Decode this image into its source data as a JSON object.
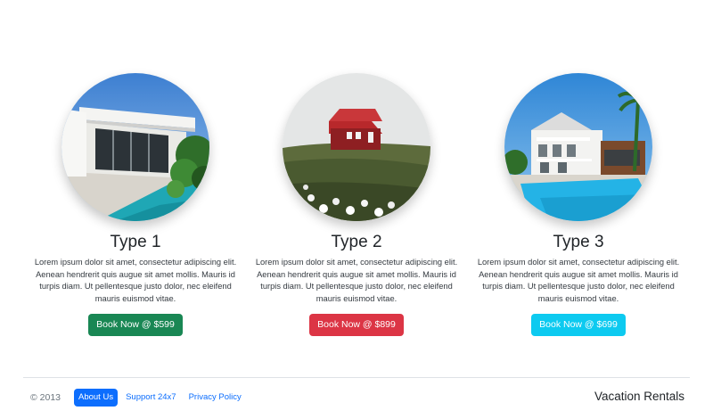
{
  "cards": [
    {
      "image": "modern-house-pool-image",
      "title": "Type 1",
      "text": "Lorem ipsum dolor sit amet, consectetur adipiscing elit. Aenean hendrerit quis augue sit amet mollis. Mauris id turpis diam. Ut pellentesque justo dolor, nec eleifend mauris euismod vitae.",
      "button_label": "Book Now @ $599",
      "button_color": "#198754"
    },
    {
      "image": "red-cabin-hill-image",
      "title": "Type 2",
      "text": "Lorem ipsum dolor sit amet, consectetur adipiscing elit. Aenean hendrerit quis augue sit amet mollis. Mauris id turpis diam. Ut pellentesque justo dolor, nec eleifend mauris euismod vitae.",
      "button_label": "Book Now @ $899",
      "button_color": "#dc3545"
    },
    {
      "image": "villa-pool-image",
      "title": "Type 3",
      "text": "Lorem ipsum dolor sit amet, consectetur adipiscing elit. Aenean hendrerit quis augue sit amet mollis. Mauris id turpis diam. Ut pellentesque justo dolor, nec eleifend mauris euismod vitae.",
      "button_label": "Book Now @ $699",
      "button_color": "#0dcaf0"
    }
  ],
  "footer": {
    "copyright": "© 2013",
    "links": [
      "About Us",
      "Support 24x7",
      "Privacy Policy"
    ],
    "active_link": "About Us",
    "brand": "Vacation Rentals"
  },
  "colors": {
    "primary": "#0d6efd",
    "text": "#212529",
    "muted": "#6c757d"
  }
}
